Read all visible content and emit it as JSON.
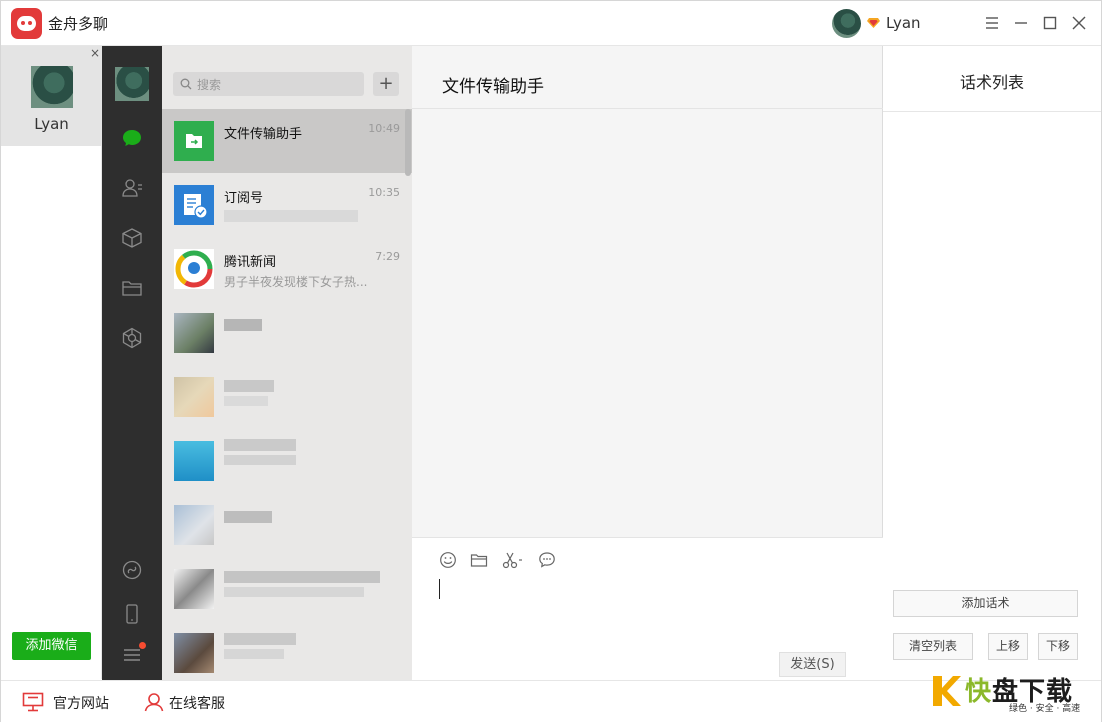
{
  "app": {
    "title": "金舟多聊",
    "username": "Lyan",
    "window_buttons": [
      "menu-icon",
      "minimize-icon",
      "maximize-icon",
      "close-icon"
    ]
  },
  "accounts": {
    "items": [
      {
        "name": "Lyan"
      }
    ],
    "close_mark": "×",
    "add_button": "添加微信"
  },
  "bottom_bar": {
    "website": "官方网站",
    "support": "在线客服"
  },
  "nav": {
    "icons": [
      "chat-icon",
      "contacts-icon",
      "box-icon",
      "folder-icon",
      "miniprogram-icon",
      "link-icon",
      "phone-icon",
      "menu-icon"
    ]
  },
  "chat_list": {
    "search_placeholder": "搜索",
    "add_label": "+",
    "items": [
      {
        "name": "文件传输助手",
        "time": "10:49",
        "preview": "",
        "active": true
      },
      {
        "name": "订阅号",
        "time": "10:35",
        "preview": ""
      },
      {
        "name": "腾讯新闻",
        "time": "7:29",
        "preview": "男子半夜发现楼下女子热..."
      }
    ]
  },
  "chat": {
    "title": "文件传输助手",
    "tools": [
      "emoji-icon",
      "folder-icon",
      "scissors-icon",
      "bubble-icon"
    ],
    "send_button": "发送(S)"
  },
  "script_panel": {
    "title": "话术列表",
    "add": "添加话术",
    "clear": "清空列表",
    "up": "上移",
    "down": "下移"
  },
  "watermark": {
    "brand_a": "快",
    "brand_b": "盘下载",
    "tagline": "绿色 · 安全 · 高速"
  },
  "colors": {
    "brand_red": "#e23a3a",
    "wechat_green": "#1aad19",
    "nav_dark": "#2e2e2e",
    "list_bg": "#e9e8e7"
  }
}
